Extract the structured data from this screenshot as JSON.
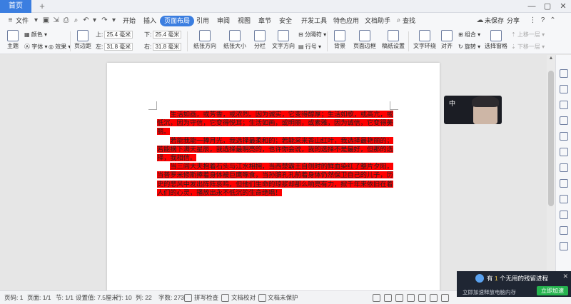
{
  "titlebar": {
    "home_tab": "首页",
    "new_tab": "+"
  },
  "menu": {
    "file": "文件",
    "tabs": [
      "开始",
      "插入",
      "页面布局",
      "引用",
      "审阅",
      "视图",
      "章节",
      "安全",
      "开发工具",
      "特色应用",
      "文档助手"
    ],
    "active_tab": "页面布局",
    "search": "查找",
    "unsaved": "未保存",
    "share": "分享"
  },
  "ribbon": {
    "theme": "主题",
    "colors": "颜色",
    "fonts": "字体",
    "effects": "效果",
    "margins": "页边距",
    "top_label": "上:",
    "top_value": "25.4 毫米",
    "bottom_label": "下:",
    "bottom_value": "25.4 毫米",
    "left_label": "左:",
    "left_value": "31.8 毫米",
    "right_label": "右:",
    "right_value": "31.8 毫米",
    "orientation": "纸张方向",
    "size": "纸张大小",
    "columns": "分栏",
    "text_direction": "文字方向",
    "separator": "分隔符",
    "line_numbers": "行号",
    "background": "背景",
    "page_border": "页面边框",
    "draft_settings": "稿纸设置",
    "text_wrap": "文字环绕",
    "align": "对齐",
    "group": "组合",
    "rotate": "旋转",
    "select_pane": "选择窗格",
    "bring_forward": "上移一层",
    "send_backward": "下移一层"
  },
  "document": {
    "paragraphs": [
      "生活如画，或芳香，或浓烈。因为诚实，它变得醇厚；生活如歌，或高亢，或低沉，因为守信，它变得悦耳；生活如画，或明丽，或素雅，因为诚信，它变得美丽。",
      "若能我能一捧月光，我选择最柔和的；若能采来香山红叶，我选择最艳丽的；若能摘下满天星辰，我选择最明亮的，也许你会说，我的选择不是最好，但那的选择，我相信。",
      "当三闾大夫抱着石头与江水相拥，当西楚霸王自刎时的鲜血染红了整片夕阳，当普罗米修斯捧着身体被巨鹰啄食，当孙膑孔孔前着身体仍然保卫自己的儿子，历史的悲风中发出阵阵哀鸣，但他们生命的琼浆却那么响亮有力，掀千年来依旧在着人们的心灵，播放出永不低沉的生命绝唱！"
    ]
  },
  "video_overlay": {
    "glyph": "中"
  },
  "statusbar": {
    "page": "页码: 1",
    "pages": "页面: 1/1",
    "section": "节: 1/1",
    "setting": "设置值: 7.5厘米",
    "row": "行: 10",
    "col": "列: 22",
    "word_count": "字数: 273",
    "spell_check": "拼写检查",
    "doc_proof": "文档校对",
    "unprotected": "文档未保护"
  },
  "popup": {
    "line1_prefix": "有",
    "line1_count": "1",
    "line1_suffix": "个无用的残留进程",
    "line2": "立即加速释放电脑内存",
    "button": "立即加速"
  },
  "colors": {
    "accent": "#3b7ee0",
    "highlight": "#ff0000",
    "popup_bg": "#1f2633",
    "popup_button": "#25b34e"
  }
}
